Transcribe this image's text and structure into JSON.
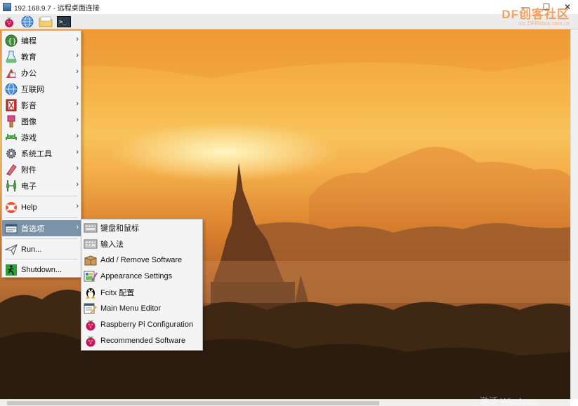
{
  "window": {
    "title": "192.168.9.7 - 远程桌面连接",
    "minimize_glyph": "—",
    "maximize_glyph": "☐",
    "close_glyph": "✕"
  },
  "watermark": {
    "logo_text": "DF创客社区",
    "sub_text": "mc.DFRobot.com.cn"
  },
  "taskbar": {
    "buttons": [
      {
        "name": "raspberry-menu-icon"
      },
      {
        "name": "web-browser-icon"
      },
      {
        "name": "file-manager-icon"
      },
      {
        "name": "terminal-icon"
      }
    ]
  },
  "main_menu": {
    "items": [
      {
        "label": "编程",
        "icon": "programming-icon",
        "has_submenu": true
      },
      {
        "label": "教育",
        "icon": "education-icon",
        "has_submenu": true
      },
      {
        "label": "办公",
        "icon": "office-icon",
        "has_submenu": true
      },
      {
        "label": "互联网",
        "icon": "internet-icon",
        "has_submenu": true
      },
      {
        "label": "影音",
        "icon": "sound-video-icon",
        "has_submenu": true
      },
      {
        "label": "图像",
        "icon": "graphics-icon",
        "has_submenu": true
      },
      {
        "label": "游戏",
        "icon": "games-icon",
        "has_submenu": true
      },
      {
        "label": "系统工具",
        "icon": "system-tools-icon",
        "has_submenu": true
      },
      {
        "label": "附件",
        "icon": "accessories-icon",
        "has_submenu": true
      },
      {
        "label": "电子",
        "icon": "electronics-icon",
        "has_submenu": true
      },
      {
        "label": "Help",
        "icon": "help-icon",
        "has_submenu": true
      },
      {
        "label": "首选项",
        "icon": "preferences-icon",
        "has_submenu": true,
        "selected": true
      },
      {
        "label": "Run...",
        "icon": "run-icon",
        "has_submenu": false
      },
      {
        "label": "Shutdown...",
        "icon": "shutdown-icon",
        "has_submenu": false
      }
    ],
    "chevron": "›"
  },
  "preferences_submenu": {
    "items": [
      {
        "label": "键盘和鼠标",
        "icon": "keyboard-mouse-icon"
      },
      {
        "label": "输入法",
        "icon": "input-method-icon"
      },
      {
        "label": "Add / Remove Software",
        "icon": "add-remove-software-icon"
      },
      {
        "label": "Appearance Settings",
        "icon": "appearance-settings-icon"
      },
      {
        "label": "Fcitx 配置",
        "icon": "fcitx-penguin-icon"
      },
      {
        "label": "Main Menu Editor",
        "icon": "menu-editor-icon"
      },
      {
        "label": "Raspberry Pi Configuration",
        "icon": "raspberry-config-icon"
      },
      {
        "label": "Recommended Software",
        "icon": "raspberry-recommended-icon"
      }
    ]
  },
  "os_overlay": {
    "activate_text": "激活 Windows"
  },
  "colors": {
    "menu_selected": "#7a93a8",
    "menu_bg": "#f4f4f4",
    "sunset_orange": "#f2a03a"
  }
}
